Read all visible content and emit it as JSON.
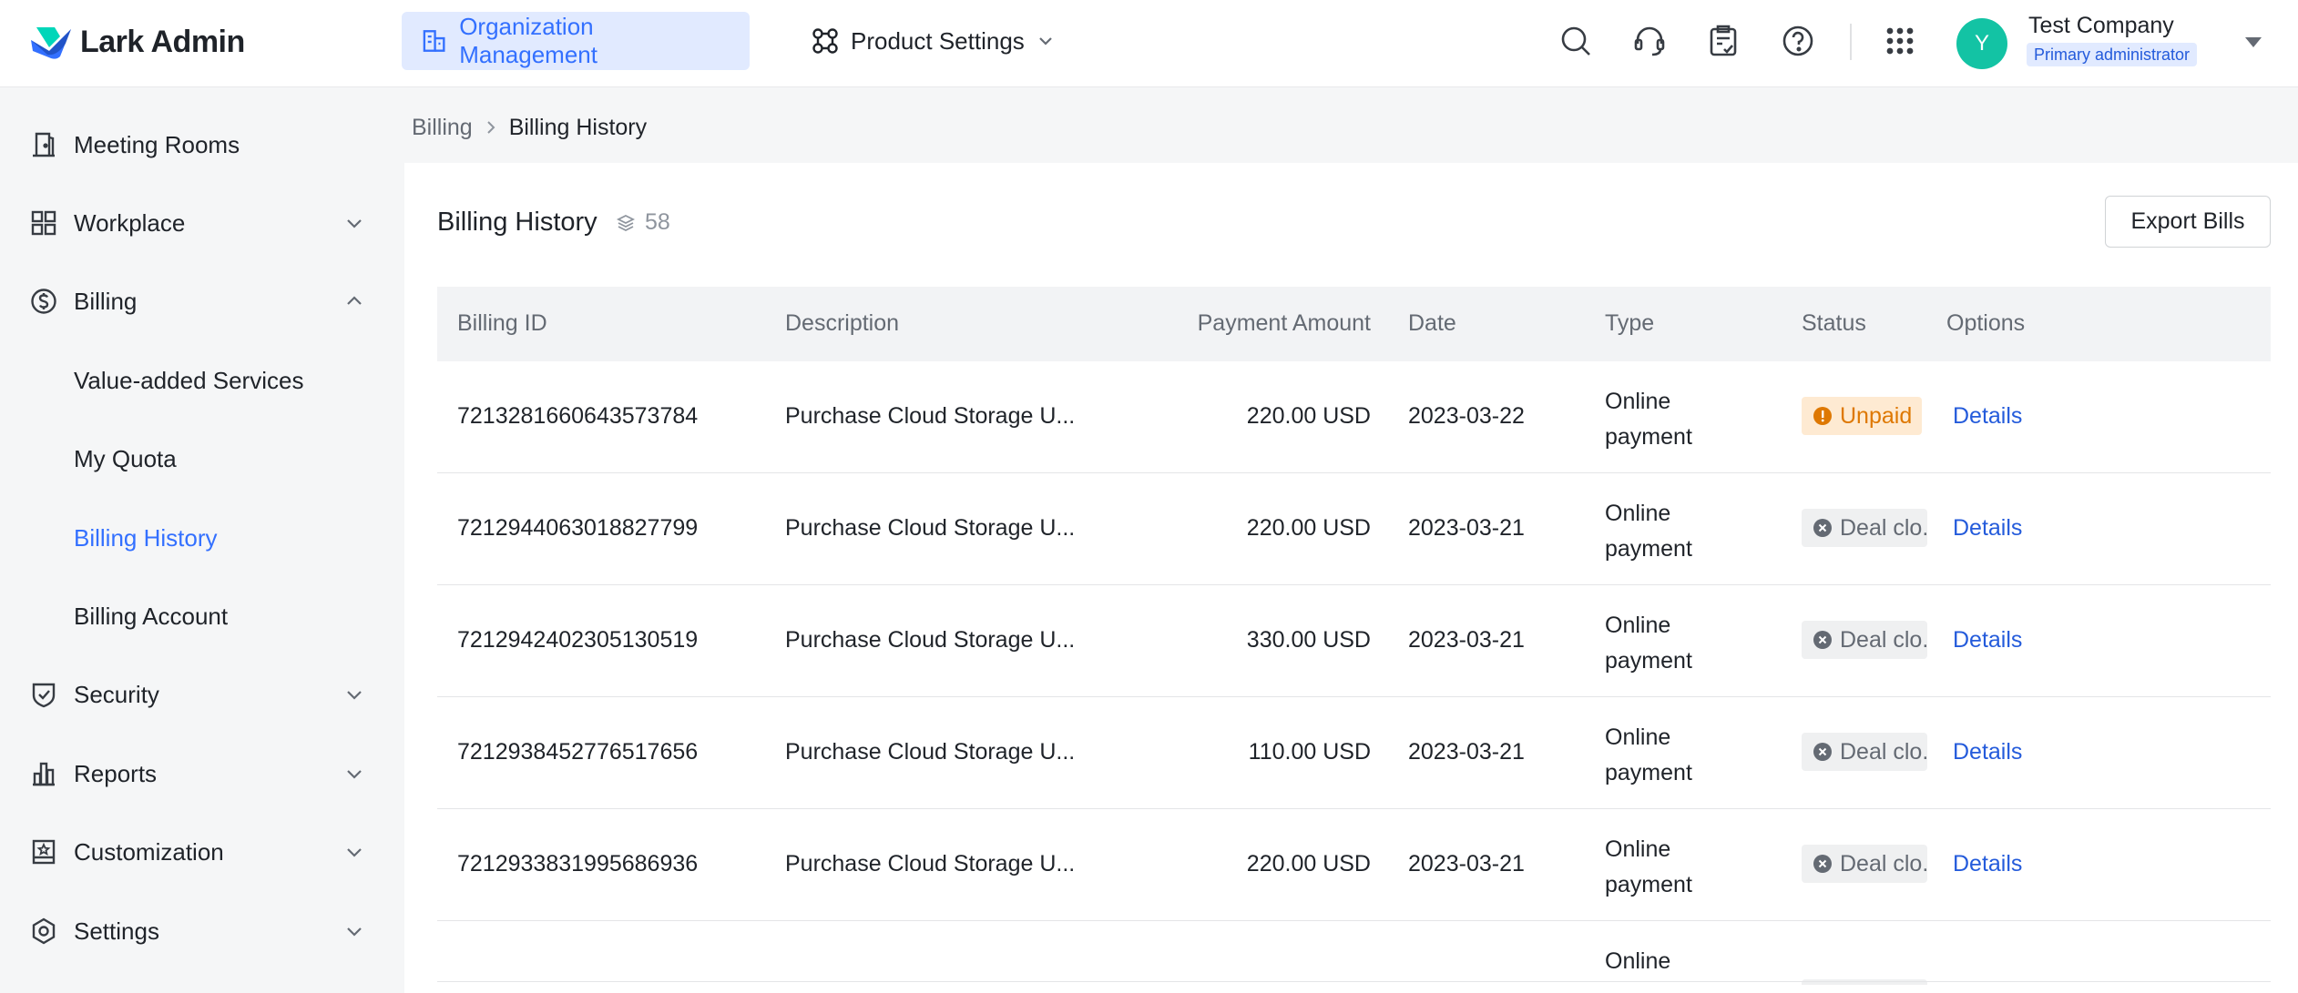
{
  "header": {
    "app_name": "Lark Admin",
    "tabs": [
      {
        "label": "Organization Management",
        "icon": "org-icon",
        "active": true
      },
      {
        "label": "Product Settings",
        "icon": "product-icon",
        "active": false
      }
    ],
    "tools": [
      "search-icon",
      "headset-icon",
      "clipboard-icon",
      "help-icon",
      "apps-grid-icon"
    ],
    "account": {
      "avatar_initial": "Y",
      "avatar_color": "#13c3a4",
      "company": "Test Company",
      "role": "Primary administrator"
    }
  },
  "sidebar": {
    "items": [
      {
        "label": "Meeting Rooms",
        "icon": "door-icon"
      },
      {
        "label": "Workplace",
        "icon": "grid-icon",
        "expandable": true
      },
      {
        "label": "Billing",
        "icon": "dollar-icon",
        "expanded": true
      },
      {
        "label": "Value-added Services",
        "sub": true
      },
      {
        "label": "My Quota",
        "sub": true
      },
      {
        "label": "Billing History",
        "sub": true,
        "selected": true
      },
      {
        "label": "Billing Account",
        "sub": true
      },
      {
        "label": "Security",
        "icon": "shield-icon",
        "expandable": true
      },
      {
        "label": "Reports",
        "icon": "bar-chart-icon",
        "expandable": true
      },
      {
        "label": "Customization",
        "icon": "star-frame-icon",
        "expandable": true
      },
      {
        "label": "Settings",
        "icon": "hexagon-gear-icon",
        "expandable": true
      }
    ]
  },
  "breadcrumb": {
    "parent": "Billing",
    "current": "Billing History"
  },
  "page": {
    "title": "Billing History",
    "count": "58",
    "export_label": "Export Bills"
  },
  "table": {
    "columns": [
      "Billing ID",
      "Description",
      "Payment Amount",
      "Date",
      "Type",
      "Status",
      "Options"
    ],
    "rows": [
      {
        "id": "7213281660643573784",
        "description": "Purchase Cloud Storage U...",
        "amount": "220.00 USD",
        "date": "2023-03-22",
        "type": "Online payment",
        "status": "Unpaid",
        "status_kind": "unpaid",
        "option": "Details"
      },
      {
        "id": "7212944063018827799",
        "description": "Purchase Cloud Storage U...",
        "amount": "220.00 USD",
        "date": "2023-03-21",
        "type": "Online payment",
        "status": "Deal clo.",
        "status_kind": "closed",
        "option": "Details"
      },
      {
        "id": "7212942402305130519",
        "description": "Purchase Cloud Storage U...",
        "amount": "330.00 USD",
        "date": "2023-03-21",
        "type": "Online payment",
        "status": "Deal clo.",
        "status_kind": "closed",
        "option": "Details"
      },
      {
        "id": "7212938452776517656",
        "description": "Purchase Cloud Storage U...",
        "amount": "110.00 USD",
        "date": "2023-03-21",
        "type": "Online payment",
        "status": "Deal clo.",
        "status_kind": "closed",
        "option": "Details"
      },
      {
        "id": "7212933831995686936",
        "description": "Purchase Cloud Storage U...",
        "amount": "220.00 USD",
        "date": "2023-03-21",
        "type": "Online payment",
        "status": "Deal clo.",
        "status_kind": "closed",
        "option": "Details"
      }
    ],
    "partial_row": {
      "type": "Online"
    }
  },
  "colors": {
    "accent": "#3370ff",
    "link": "#245bdb",
    "unpaid_bg": "#feead2",
    "unpaid_fg": "#de7802",
    "closed_bg": "#eff0f1",
    "closed_fg": "#646a73"
  }
}
